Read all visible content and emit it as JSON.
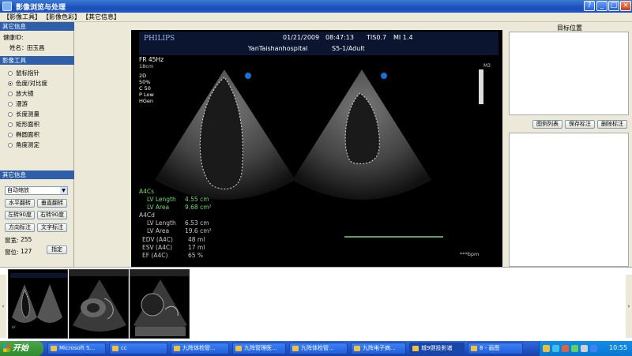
{
  "window": {
    "title": "影像浏览与处理",
    "controls": {
      "help": "?",
      "minimize": "_",
      "maximize": "□",
      "close": "×"
    }
  },
  "menu": {
    "items": [
      "【影像工具】",
      "【影像色彩】",
      "【其它信息】"
    ]
  },
  "left": {
    "other_info_header": "其它信息",
    "health_id_label": "健康ID:",
    "name_label": "姓名：",
    "name_value": "田玉昌",
    "tools_header": "影像工具",
    "tools": [
      "鼠标指针",
      "色度/对比度",
      "放大镜",
      "漫游",
      "长度测量",
      "矩形面积",
      "椭圆面积",
      "角度测定"
    ],
    "selected_tool": "色度/对比度",
    "other_info_header2": "其它信息",
    "combo_value": "自动缩放",
    "buttons": [
      [
        "水平翻转",
        "垂直翻转"
      ],
      [
        "左转90度",
        "右转90度"
      ],
      [
        "方向标注",
        "文字标注"
      ]
    ],
    "window_width_label": "窗宽:",
    "window_width_value": "255",
    "window_level_label": "窗位:",
    "window_level_value": "127",
    "assign_button": "指定"
  },
  "ultrasound": {
    "brand": "PHILIPS",
    "date": "01/21/2009",
    "time": "08:47:13",
    "tis": "TIS0.7",
    "mi": "MI 1.4",
    "hospital": "YanTaishanhospital",
    "probe": "S5-1/Adult",
    "fr": "FR 45Hz",
    "depth": "18cm",
    "mode_lines": [
      "2D",
      "50%",
      "C 50",
      "P Low",
      "HGen"
    ],
    "m3": "M3",
    "a4cs": "A4Cs",
    "lv_length_s_label": "LV Length",
    "lv_length_s": "4.55 cm",
    "lv_area_s_label": "LV Area",
    "lv_area_s": "9.68 cm²",
    "a4cd": "A4Cd",
    "lv_length_d_label": "LV Length",
    "lv_length_d": "6.53 cm",
    "lv_area_d_label": "LV Area",
    "lv_area_d": "19.6 cm²",
    "edv_label": "EDV (A4C)",
    "edv": "48 ml",
    "esv_label": "ESV (A4C)",
    "esv": "17 ml",
    "ef_label": "EF (A4C)",
    "ef": "65 %",
    "bpm": "***bpm"
  },
  "right": {
    "target_title": "目标位置",
    "buttons": [
      "图例列表",
      "保存标注",
      "删除标注"
    ]
  },
  "thumbstrip": {
    "scroll_left": "‹",
    "scroll_right": "›"
  },
  "taskbar": {
    "start": "开始",
    "tasks": [
      "Microsoft S...",
      "cc",
      "九阵体检管...",
      "九阵管理医...",
      "九阵体检管...",
      "九阵电子病...",
      "城9健投影诸",
      "8 - 画图"
    ],
    "active_index": 6,
    "clock": "10:55"
  }
}
